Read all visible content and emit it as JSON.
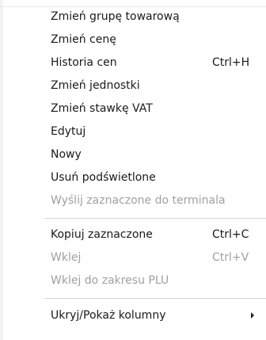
{
  "menu": {
    "items": [
      {
        "label": "Zmień grupę towarową",
        "shortcut": "",
        "enabled": true
      },
      {
        "label": "Zmień cenę",
        "shortcut": "",
        "enabled": true
      },
      {
        "label": "Historia cen",
        "shortcut": "Ctrl+H",
        "enabled": true
      },
      {
        "label": "Zmień jednostki",
        "shortcut": "",
        "enabled": true
      },
      {
        "label": "Zmień stawkę VAT",
        "shortcut": "",
        "enabled": true
      },
      {
        "label": "Edytuj",
        "shortcut": "",
        "enabled": true
      },
      {
        "label": "Nowy",
        "shortcut": "",
        "enabled": true
      },
      {
        "label": "Usuń podświetlone",
        "shortcut": "",
        "enabled": true
      },
      {
        "label": "Wyślij zaznaczone do terminala",
        "shortcut": "",
        "enabled": false
      },
      {
        "label": "Kopiuj zaznaczone",
        "shortcut": "Ctrl+C",
        "enabled": true
      },
      {
        "label": "Wklej",
        "shortcut": "Ctrl+V",
        "enabled": false
      },
      {
        "label": "Wklej do zakresu PLU",
        "shortcut": "",
        "enabled": false
      },
      {
        "label": "Ukryj/Pokaż kolumny",
        "shortcut": "",
        "enabled": true,
        "submenu": true
      }
    ]
  }
}
